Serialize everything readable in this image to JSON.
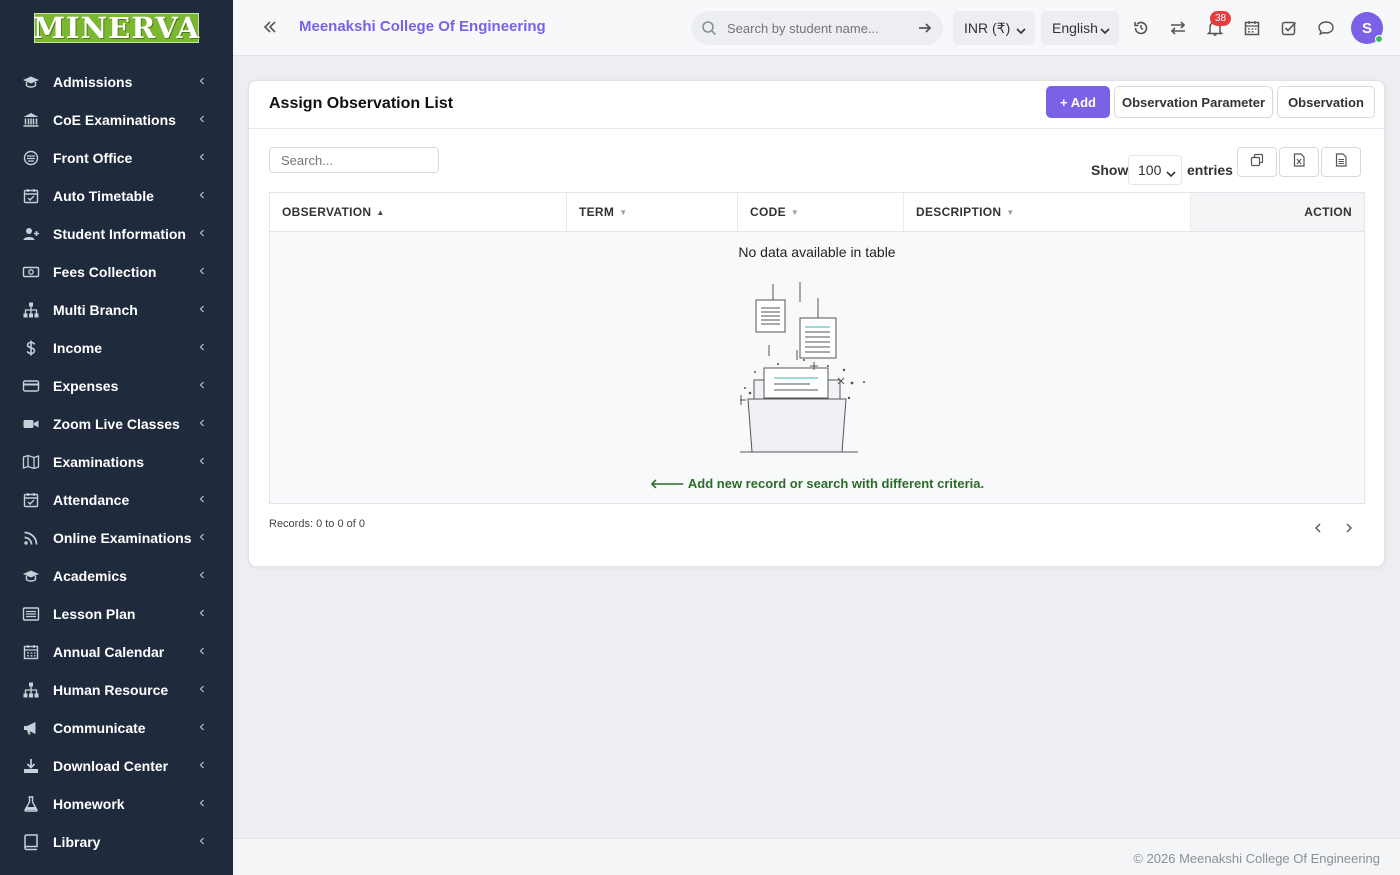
{
  "sidebar": {
    "logo_text": "MINERVA",
    "items": [
      {
        "label": "Admissions",
        "icon": "graduation-cap-icon"
      },
      {
        "label": "CoE Examinations",
        "icon": "institution-icon"
      },
      {
        "label": "Front Office",
        "icon": "front-office-icon"
      },
      {
        "label": "Auto Timetable",
        "icon": "calendar-check-icon"
      },
      {
        "label": "Student Information",
        "icon": "user-plus-icon"
      },
      {
        "label": "Fees Collection",
        "icon": "money-icon"
      },
      {
        "label": "Multi Branch",
        "icon": "sitemap-icon"
      },
      {
        "label": "Income",
        "icon": "dollar-icon"
      },
      {
        "label": "Expenses",
        "icon": "credit-card-icon"
      },
      {
        "label": "Zoom Live Classes",
        "icon": "video-camera-icon"
      },
      {
        "label": "Examinations",
        "icon": "map-icon"
      },
      {
        "label": "Attendance",
        "icon": "calendar-check-icon"
      },
      {
        "label": "Online Examinations",
        "icon": "rss-icon"
      },
      {
        "label": "Academics",
        "icon": "graduation-cap-icon"
      },
      {
        "label": "Lesson Plan",
        "icon": "list-alt-icon"
      },
      {
        "label": "Annual Calendar",
        "icon": "calendar-icon"
      },
      {
        "label": "Human Resource",
        "icon": "sitemap-icon"
      },
      {
        "label": "Communicate",
        "icon": "bullhorn-icon"
      },
      {
        "label": "Download Center",
        "icon": "download-icon"
      },
      {
        "label": "Homework",
        "icon": "flask-icon"
      },
      {
        "label": "Library",
        "icon": "book-icon"
      }
    ]
  },
  "topbar": {
    "college_name": "Meenakshi College Of Engineering",
    "search_placeholder": "Search by student name...",
    "currency": "INR (₹)",
    "language": "English",
    "notification_count": "38",
    "avatar_initial": "S"
  },
  "card": {
    "title": "Assign Observation List",
    "add_label": "+ Add",
    "observation_parameter_label": "Observation Parameter",
    "observation_label": "Observation",
    "search_placeholder": "Search...",
    "show_label": "Show",
    "entries_value": "100",
    "entries_label": "entries"
  },
  "table": {
    "columns": [
      "OBSERVATION",
      "TERM",
      "CODE",
      "DESCRIPTION",
      "ACTION"
    ],
    "sorted_column": "OBSERVATION",
    "empty_text": "No data available in table",
    "empty_hint": "Add new record or search with different criteria.",
    "records_text": "Records: 0 to 0 of 0"
  },
  "footer": {
    "text": "© 2026 Meenakshi College Of Engineering"
  },
  "colors": {
    "accent": "#7a61e6",
    "sidebar_bg": "#1f2b3d",
    "hint_green": "#2d6b2a",
    "badge_red": "#e43d3d"
  }
}
